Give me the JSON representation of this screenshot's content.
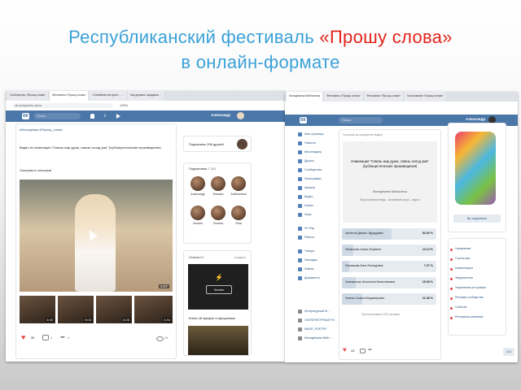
{
  "slide": {
    "title_line1_prefix": "Республиканский фестиваль ",
    "title_line1_quote": "«Прошу слова»",
    "title_line2": "в онлайн-формате"
  },
  "left_screen": {
    "tabs": [
      "Сообщество «Прошу слова»",
      "Фестиваль «Прошу слова»",
      "«Семейная история» - …",
      "Как держать ожидание…"
    ],
    "url": "vk.com/proshu_slova",
    "zoom": "125%",
    "search_placeholder": "Поиск",
    "user_name": "Александр",
    "post": {
      "hashtags": "#Молодёжка #Прошу_слова",
      "text": "Видео из номинации \"Сквозь жар души, сквозь холод ума\" (публицистические произведения)",
      "cta": "Смотрим и голосуем!",
      "main_duration": "6:57",
      "thumbs": [
        {
          "duration": "6:40"
        },
        {
          "duration": "5:03"
        },
        {
          "duration": "6:26"
        },
        {
          "duration": "4:34"
        }
      ],
      "likes": "30",
      "comments": "4",
      "shares": "4",
      "views": "16"
    },
    "sidebar": {
      "friends_label": "Подписаны 296 друзей",
      "subscribers_label": "Подписчики",
      "subscribers_count": "2 364",
      "subscribers_row1": [
        "Александр",
        "Фомина",
        "Библиотека"
      ],
      "subscribers_row2": [
        "Казнин",
        "Полина",
        "Олга"
      ],
      "articles_label": "Статьи",
      "articles_count": "86",
      "articles_more": "создать",
      "read_button": "Читать",
      "book_title": "Книги об афорах и афоризмах"
    }
  },
  "right_screen": {
    "tabs": [
      "Молодёжная библиотека",
      "Фестиваль «Прошу слова»",
      "Фестиваль «Прошу слова»",
      "Голосование «Прошу слова»"
    ],
    "search_placeholder": "Поиск",
    "user_name": "Александр",
    "menu": [
      "Моя страница",
      "Новости",
      "Мессенджер",
      "Друзья",
      "Сообщества",
      "Фотографии",
      "Музыка",
      "Видео",
      "Клипы",
      "Игры",
      "VK Pay",
      "Работа",
      "Товары",
      "Закладки",
      "Файлы",
      "Документы"
    ],
    "groups": [
      "Литературный М…",
      "«ЛИТЕРАТУРНЫЙ НУ…",
      "МЫЗЕ_POETRY",
      "Молодёжная библ…"
    ],
    "poll": {
      "title": "Номинация \"Сквозь жар души, сквозь холод ума\" (публицистические произведения)",
      "subtitle": "Молодёжная библиотека",
      "type": "Персональная пейдж - анонимный опрос - закрыт",
      "header": "Голосуем за конкурсное видео!",
      "options": [
        {
          "name": "Кречетов Даниил Эдуардович",
          "pct": "52.93 %",
          "value": 52.93
        },
        {
          "name": "Пименская Алина Игоревна",
          "pct": "12.14 %",
          "value": 12.14
        },
        {
          "name": "Пермякова Анна Леонидовна",
          "pct": "7.37 %",
          "value": 7.37
        },
        {
          "name": "Чернышенко Анастасия Вячеславовна",
          "pct": "15.08 %",
          "value": 15.08
        },
        {
          "name": "Ушенко София Владимировна",
          "pct": "21.38 %",
          "value": 21.38
        }
      ],
      "voted": "Проголосовало 239 человек",
      "likes": "43"
    },
    "right_panel": {
      "subscribe_button": "Вы подписаны",
      "menu": [
        "Управление",
        "Статистика",
        "Комментарии",
        "Уведомления",
        "Управление историями",
        "Реклама сообщества",
        "Событие",
        "Рекламная кампания"
      ]
    },
    "chat_badge": "113"
  },
  "colors": {
    "title_blue": "#3aa1d8",
    "title_red": "#e2231a",
    "vk_header": "#4a76a8",
    "link": "#2a5885"
  }
}
